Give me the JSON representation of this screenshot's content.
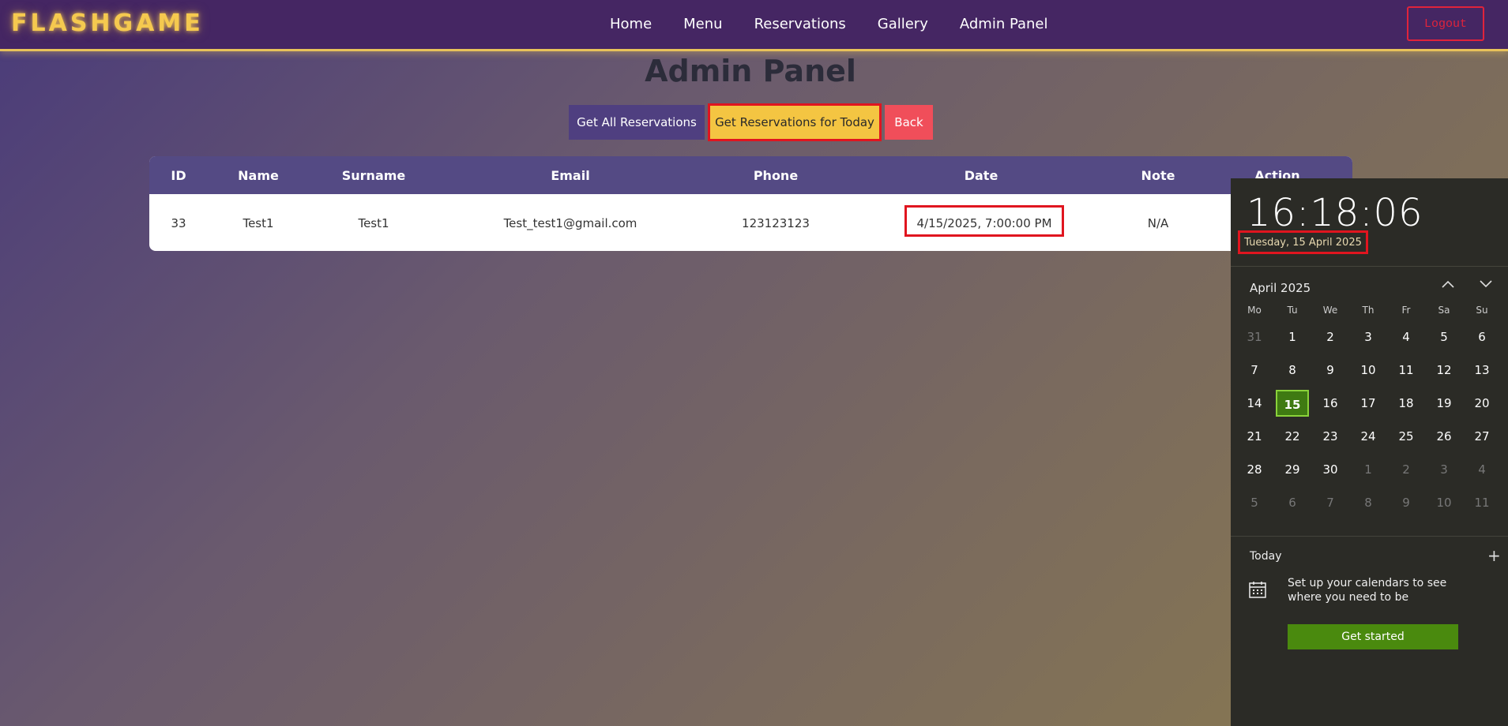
{
  "header": {
    "logo": "FLASHGAME",
    "nav": [
      "Home",
      "Menu",
      "Reservations",
      "Gallery",
      "Admin Panel"
    ],
    "logout": "Logout"
  },
  "main": {
    "title": "Admin Panel",
    "buttons": {
      "all": "Get All Reservations",
      "today": "Get Reservations for Today",
      "back": "Back"
    },
    "table": {
      "columns": [
        "ID",
        "Name",
        "Surname",
        "Email",
        "Phone",
        "Date",
        "Note",
        "Action"
      ],
      "rows": [
        {
          "id": "33",
          "name": "Test1",
          "surname": "Test1",
          "email": "Test_test1@gmail.com",
          "phone": "123123123",
          "date": "4/15/2025, 7:00:00 PM",
          "note": "N/A"
        }
      ]
    }
  },
  "calendar": {
    "time": "16:18:06",
    "full_date": "Tuesday, 15 April 2025",
    "month": "April 2025",
    "weekdays": [
      "Mo",
      "Tu",
      "We",
      "Th",
      "Fr",
      "Sa",
      "Su"
    ],
    "weeks": [
      [
        "31",
        "1",
        "2",
        "3",
        "4",
        "5",
        "6"
      ],
      [
        "7",
        "8",
        "9",
        "10",
        "11",
        "12",
        "13"
      ],
      [
        "14",
        "15",
        "16",
        "17",
        "18",
        "19",
        "20"
      ],
      [
        "21",
        "22",
        "23",
        "24",
        "25",
        "26",
        "27"
      ],
      [
        "28",
        "29",
        "30",
        "1",
        "2",
        "3",
        "4"
      ],
      [
        "5",
        "6",
        "7",
        "8",
        "9",
        "10",
        "11"
      ]
    ],
    "today_label": "Today",
    "setup_text": "Set up your calendars to see where you need to be",
    "get_started": "Get started",
    "accent_color": "#4a8a0e",
    "highlight_color": "#e0151f"
  }
}
